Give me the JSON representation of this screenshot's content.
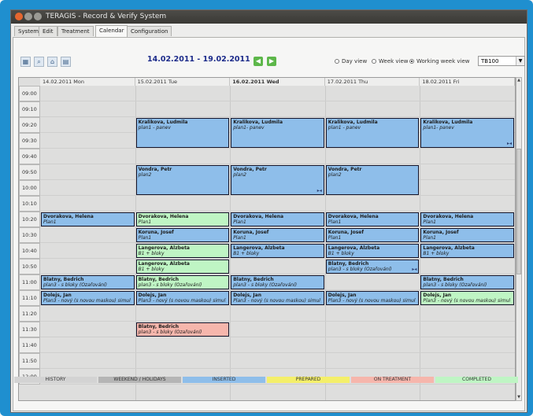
{
  "window": {
    "title": "TERAGIS - Record & Verify System"
  },
  "menu_tabs": [
    {
      "label": "System"
    },
    {
      "label": "Edit"
    },
    {
      "label": "Treatment"
    },
    {
      "label": "Calendar"
    },
    {
      "label": "Configuration"
    }
  ],
  "toolbar": {
    "date_range": "14.02.2011 - 19.02.2011",
    "prev_icon": "arrow-left-icon",
    "next_icon": "arrow-right-icon",
    "views": [
      {
        "label": "Day view",
        "selected": false
      },
      {
        "label": "Week view",
        "selected": false
      },
      {
        "label": "Working week view",
        "selected": true
      }
    ],
    "room_value": "TB100"
  },
  "days": [
    {
      "label": "14.02.2011 Mon",
      "bold": false
    },
    {
      "label": "15.02.2011 Tue",
      "bold": false
    },
    {
      "label": "16.02.2011 Wed",
      "bold": true
    },
    {
      "label": "17.02.2011 Thu",
      "bold": false
    },
    {
      "label": "18.02.2011 Fri",
      "bold": false
    }
  ],
  "times": [
    "09:00",
    "09:10",
    "09:20",
    "09:30",
    "09:40",
    "09:50",
    "10:00",
    "10:10",
    "10:20",
    "10:30",
    "10:40",
    "10:50",
    "11:00",
    "11:10",
    "11:20",
    "11:30",
    "11:40",
    "11:50",
    "12:00"
  ],
  "appointments": [
    {
      "day": 1,
      "slot": 2,
      "span": 2,
      "status": "blue",
      "name": "Kralikova, Ludmila",
      "plan": "plan1 - panev"
    },
    {
      "day": 2,
      "slot": 2,
      "span": 2,
      "status": "blue",
      "name": "Kralikova, Ludmila",
      "plan": "plan1- panev"
    },
    {
      "day": 3,
      "slot": 2,
      "span": 2,
      "status": "blue",
      "name": "Kralikova, Ludmila",
      "plan": "plan1 - panev"
    },
    {
      "day": 4,
      "slot": 2,
      "span": 2,
      "status": "blue",
      "name": "Kralikova, Ludmila",
      "plan": "plan1- panev",
      "mark": "▸◂"
    },
    {
      "day": 1,
      "slot": 5,
      "span": 2,
      "status": "blue",
      "name": "Vondra, Petr",
      "plan": "plan2"
    },
    {
      "day": 2,
      "slot": 5,
      "span": 2,
      "status": "blue",
      "name": "Vondra, Petr",
      "plan": "plan2",
      "mark": "▸◂"
    },
    {
      "day": 3,
      "slot": 5,
      "span": 2,
      "status": "blue",
      "name": "Vondra, Petr",
      "plan": "plan2"
    },
    {
      "day": 0,
      "slot": 8,
      "span": 1,
      "status": "blue",
      "name": "Dvorakova, Helena",
      "plan": "Plan1"
    },
    {
      "day": 1,
      "slot": 8,
      "span": 1,
      "status": "green",
      "name": "Dvorakova, Helena",
      "plan": "Plan1"
    },
    {
      "day": 2,
      "slot": 8,
      "span": 1,
      "status": "blue",
      "name": "Dvorakova, Helena",
      "plan": "Plan1"
    },
    {
      "day": 3,
      "slot": 8,
      "span": 1,
      "status": "blue",
      "name": "Dvorakova, Helena",
      "plan": "Plan1"
    },
    {
      "day": 4,
      "slot": 8,
      "span": 1,
      "status": "blue",
      "name": "Dvorakova, Helena",
      "plan": "Plan1"
    },
    {
      "day": 1,
      "slot": 9,
      "span": 1,
      "status": "blue",
      "name": "Koruna, Josef",
      "plan": "Plan1"
    },
    {
      "day": 2,
      "slot": 9,
      "span": 1,
      "status": "blue",
      "name": "Koruna, Josef",
      "plan": "Plan1"
    },
    {
      "day": 3,
      "slot": 9,
      "span": 1,
      "status": "blue",
      "name": "Koruna, Josef",
      "plan": "Plan1"
    },
    {
      "day": 4,
      "slot": 9,
      "span": 1,
      "status": "blue",
      "name": "Koruna, Josef",
      "plan": "Plan1"
    },
    {
      "day": 1,
      "slot": 10,
      "span": 1,
      "status": "green",
      "name": "Langerova, Alzbeta",
      "plan": "B1 + bloky"
    },
    {
      "day": 2,
      "slot": 10,
      "span": 1,
      "status": "blue",
      "name": "Langerova, Alzbeta",
      "plan": "B1 + bloky"
    },
    {
      "day": 3,
      "slot": 10,
      "span": 1,
      "status": "blue",
      "name": "Langerova, Alzbeta",
      "plan": "B1 + bloky"
    },
    {
      "day": 4,
      "slot": 10,
      "span": 1,
      "status": "blue",
      "name": "Langerova, Alzbeta",
      "plan": "B1 + bloky"
    },
    {
      "day": 1,
      "slot": 11,
      "span": 1,
      "status": "green",
      "name": "Langerova, Alzbeta",
      "plan": "B1 + bloky"
    },
    {
      "day": 3,
      "slot": 11,
      "span": 1,
      "status": "blue",
      "name": "Blatny, Bedrich",
      "plan": "plan3 - s bloky (Ozařování)",
      "mark": "▸◂"
    },
    {
      "day": 0,
      "slot": 12,
      "span": 1,
      "status": "blue",
      "name": "Blatny, Bedrich",
      "plan": "plan3 - s bloky (Ozařování)"
    },
    {
      "day": 1,
      "slot": 12,
      "span": 1,
      "status": "green",
      "name": "Blatny, Bedrich",
      "plan": "plan3 - s bloky (Ozařování)"
    },
    {
      "day": 2,
      "slot": 12,
      "span": 1,
      "status": "blue",
      "name": "Blatny, Bedrich",
      "plan": "plan3 - s bloky (Ozařování)"
    },
    {
      "day": 4,
      "slot": 12,
      "span": 1,
      "status": "blue",
      "name": "Blatny, Bedrich",
      "plan": "plan3 - s bloky (Ozařování)"
    },
    {
      "day": 0,
      "slot": 13,
      "span": 1,
      "status": "blue",
      "name": "Dolejs, Jan",
      "plan": "Plan3 - nový (s novou maskou) simul"
    },
    {
      "day": 1,
      "slot": 13,
      "span": 1,
      "status": "blue",
      "name": "Dolejs, Jan",
      "plan": "Plan3 - nový (s novou maskou) simul"
    },
    {
      "day": 2,
      "slot": 13,
      "span": 1,
      "status": "blue",
      "name": "Dolejs, Jan",
      "plan": "Plan3 - nový (s novou maskou) simul"
    },
    {
      "day": 3,
      "slot": 13,
      "span": 1,
      "status": "blue",
      "name": "Dolejs, Jan",
      "plan": "Plan3 - nový (s novou maskou) simul"
    },
    {
      "day": 4,
      "slot": 13,
      "span": 1,
      "status": "green",
      "name": "Dolejs, Jan",
      "plan": "Plan3 - nový (s novou maskou) simul"
    },
    {
      "day": 1,
      "slot": 15,
      "span": 1,
      "status": "red",
      "name": "Blatny, Bedrich",
      "plan": "plan3 - s bloky (Ozařování)"
    }
  ],
  "legend": [
    {
      "label": "HISTORY",
      "color": "#d3d3d3"
    },
    {
      "label": "WEEKEND / HOLIDAYS",
      "color": "#b5b5b5"
    },
    {
      "label": "INSERTED",
      "color": "#8ebeea"
    },
    {
      "label": "PREPARED",
      "color": "#f4ef6a"
    },
    {
      "label": "ON TREATMENT",
      "color": "#f6b6ac"
    },
    {
      "label": "COMPLETED",
      "color": "#bff5c4"
    }
  ],
  "colors": {
    "inserted": "#8ebeea",
    "completed": "#bff5c4",
    "on_treatment": "#f6b6ac",
    "date_range": "#1c2b8a"
  }
}
